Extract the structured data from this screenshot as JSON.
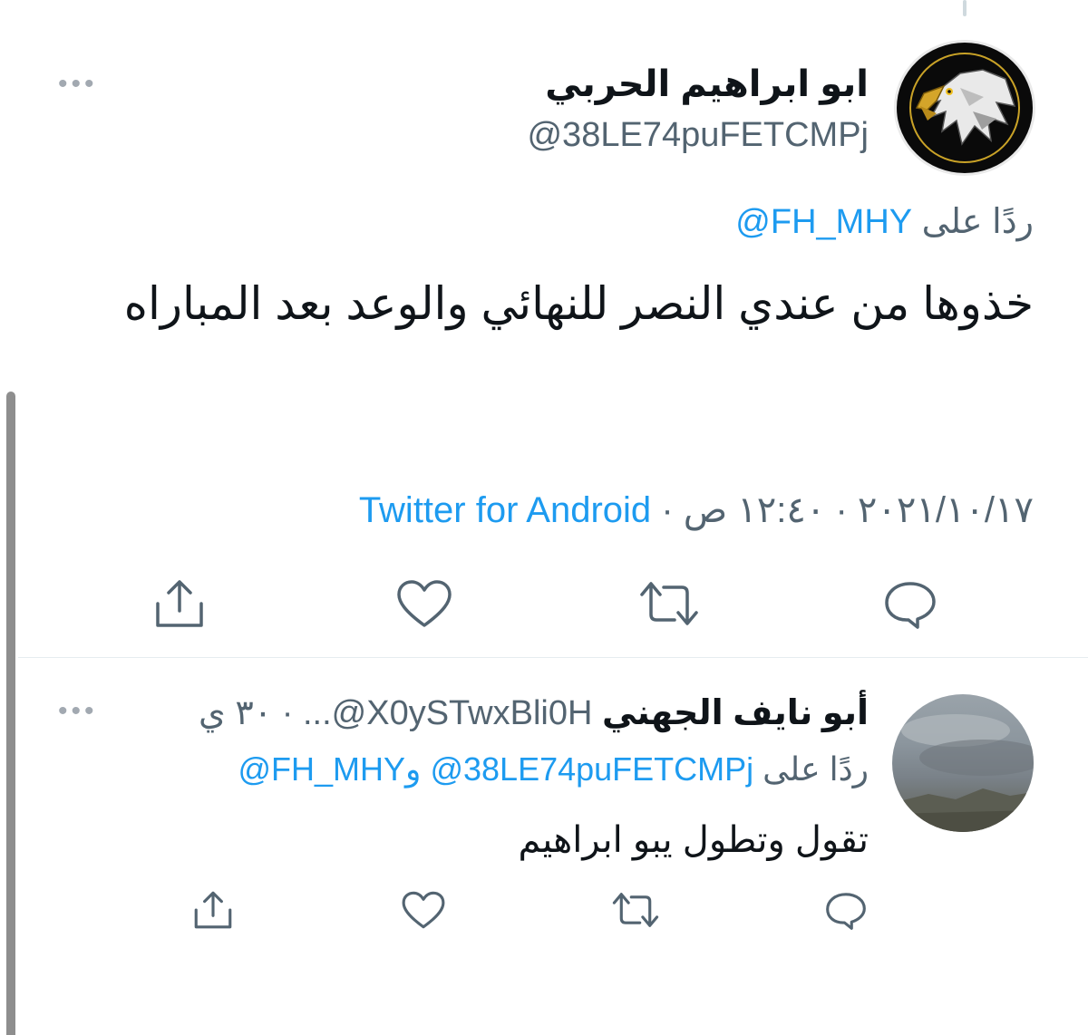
{
  "tweet": {
    "author_name": "ابو ابراهيم الحربي",
    "author_handle": "@38LE74puFETCMPj",
    "replying_prefix": "ردًا على",
    "replying_to": "@FH_MHY",
    "text": "خذوها من عندي النصر للنهائي والوعد بعد المباراه",
    "date": "٢٠٢١/١٠/١٧",
    "time": "١٢:٤٠ ص",
    "separator": "·",
    "source": "Twitter for Android",
    "more_label": "•••",
    "avatar_icon": "eagle-icon"
  },
  "reply": {
    "author_name": "أبو نايف الجهني",
    "author_handle_truncated": "...@X0ySTwxBli0H",
    "separator": "·",
    "time_ago": "٣٠ ي",
    "replying_prefix": "ردًا على",
    "replying_to_1": "@38LE74puFETCMPj",
    "replying_conj": "و",
    "replying_to_2": "@FH_MHY",
    "text": "تقول وتطول يبو ابراهيم",
    "more_label": "•••"
  },
  "icons": {
    "reply": "reply-icon",
    "retweet": "retweet-icon",
    "like": "like-icon",
    "share": "share-icon"
  },
  "colors": {
    "link": "#1d9bf0",
    "secondary_text": "#536471",
    "primary_text": "#0f1419"
  }
}
